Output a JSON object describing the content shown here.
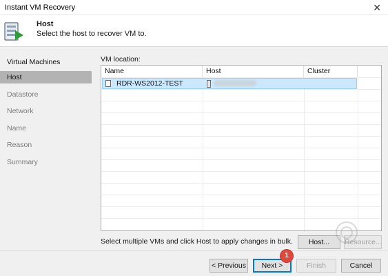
{
  "window": {
    "title": "Instant VM Recovery",
    "close_glyph": "✕"
  },
  "header": {
    "title": "Host",
    "subtitle": "Select the host to recover VM to.",
    "icon": "database-server-arrow-icon"
  },
  "sidebar": {
    "items": [
      {
        "label": "Virtual Machines",
        "state": "done"
      },
      {
        "label": "Host",
        "state": "active"
      },
      {
        "label": "Datastore",
        "state": "pending"
      },
      {
        "label": "Network",
        "state": "pending"
      },
      {
        "label": "Name",
        "state": "pending"
      },
      {
        "label": "Reason",
        "state": "pending"
      },
      {
        "label": "Summary",
        "state": "pending"
      }
    ]
  },
  "vm_location": {
    "label": "VM location:",
    "columns": [
      "Name",
      "Host",
      "Cluster Resource"
    ],
    "rows": [
      {
        "name": "RDR-WS2012-TEST",
        "host": "",
        "cluster_resource": "",
        "selected": true
      }
    ]
  },
  "hint": "Select multiple VMs and click Host to apply changes in bulk.",
  "buttons": {
    "host": "Host...",
    "resource": "Resource...",
    "previous": "< Previous",
    "next": "Next >",
    "finish": "Finish",
    "cancel": "Cancel"
  },
  "badge": {
    "value": "1",
    "color": "#e0483b"
  },
  "colors": {
    "selection": "#cce8ff",
    "sidebar_active": "#b3b3b3",
    "panel_bg": "#f0f0f0"
  }
}
